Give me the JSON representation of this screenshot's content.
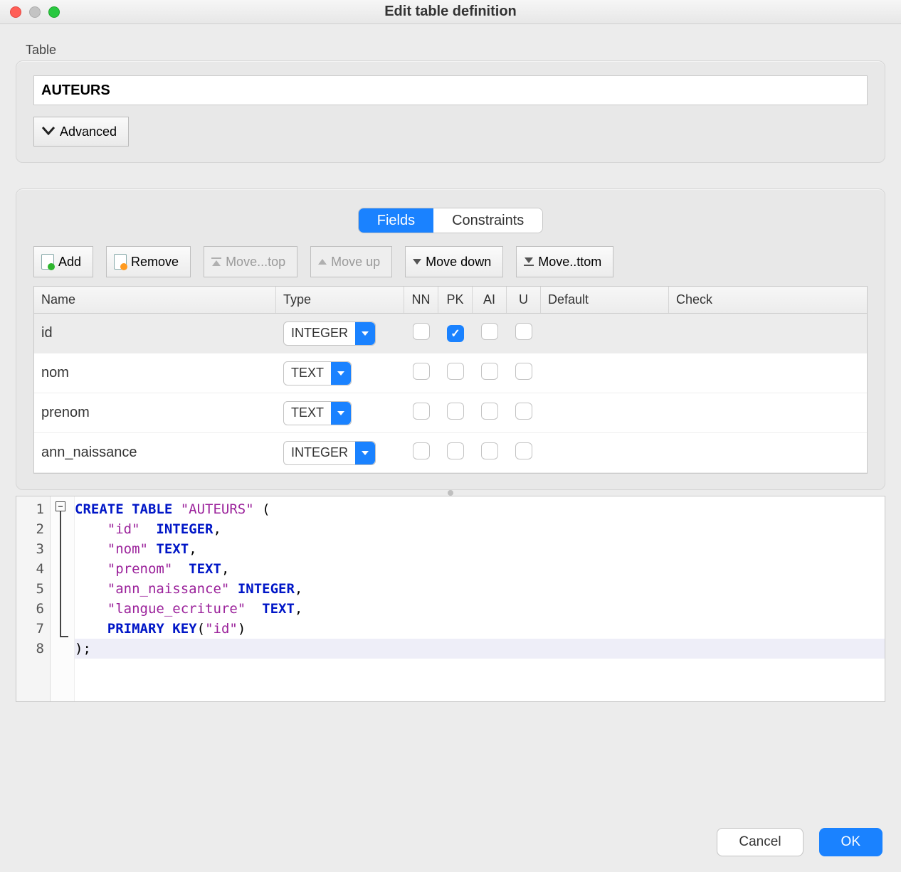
{
  "window": {
    "title": "Edit table definition"
  },
  "table_section": {
    "label": "Table",
    "name_value": "AUTEURS",
    "advanced_label": "Advanced"
  },
  "tabs": {
    "fields": "Fields",
    "constraints": "Constraints",
    "active": "fields"
  },
  "toolbar": {
    "add": "Add",
    "remove": "Remove",
    "move_top": "Move...top",
    "move_up": "Move up",
    "move_down": "Move down",
    "move_bottom": "Move..ttom"
  },
  "columns": {
    "name": "Name",
    "type": "Type",
    "nn": "NN",
    "pk": "PK",
    "ai": "AI",
    "u": "U",
    "default": "Default",
    "check": "Check"
  },
  "fields": [
    {
      "name": "id",
      "type": "INTEGER",
      "nn": false,
      "pk": true,
      "ai": false,
      "u": false,
      "default": "",
      "selected": true
    },
    {
      "name": "nom",
      "type": "TEXT",
      "nn": false,
      "pk": false,
      "ai": false,
      "u": false,
      "default": "",
      "selected": false
    },
    {
      "name": "prenom",
      "type": "TEXT",
      "nn": false,
      "pk": false,
      "ai": false,
      "u": false,
      "default": "",
      "selected": false
    },
    {
      "name": "ann_naissance",
      "type": "INTEGER",
      "nn": false,
      "pk": false,
      "ai": false,
      "u": false,
      "default": "",
      "selected": false
    }
  ],
  "sql": {
    "line_count": 8,
    "tokens": {
      "create_table": "CREATE TABLE",
      "auteurs": "\"AUTEURS\"",
      "id": "\"id\"",
      "integer": "INTEGER",
      "nom": "\"nom\"",
      "text": "TEXT",
      "prenom": "\"prenom\"",
      "ann": "\"ann_naissance\"",
      "langue": "\"langue_ecriture\"",
      "pkey": "PRIMARY KEY"
    }
  },
  "footer": {
    "cancel": "Cancel",
    "ok": "OK"
  }
}
